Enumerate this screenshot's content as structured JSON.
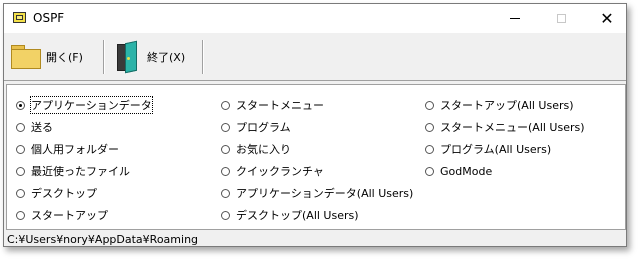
{
  "window": {
    "title": "OSPF"
  },
  "toolbar": {
    "open_label": "開く(F)",
    "exit_label": "終了(X)"
  },
  "options": {
    "col1": [
      {
        "label": "アプリケーションデータ",
        "selected": true
      },
      {
        "label": "送る",
        "selected": false
      },
      {
        "label": "個人用フォルダー",
        "selected": false
      },
      {
        "label": "最近使ったファイル",
        "selected": false
      },
      {
        "label": "デスクトップ",
        "selected": false
      },
      {
        "label": "スタートアップ",
        "selected": false
      }
    ],
    "col2": [
      {
        "label": "スタートメニュー",
        "selected": false
      },
      {
        "label": "プログラム",
        "selected": false
      },
      {
        "label": "お気に入り",
        "selected": false
      },
      {
        "label": "クイックランチャ",
        "selected": false
      },
      {
        "label": "アプリケーションデータ(All Users)",
        "selected": false
      },
      {
        "label": "デスクトップ(All Users)",
        "selected": false
      }
    ],
    "col3": [
      {
        "label": "スタートアップ(All Users)",
        "selected": false
      },
      {
        "label": "スタートメニュー(All Users)",
        "selected": false
      },
      {
        "label": "プログラム(All Users)",
        "selected": false
      },
      {
        "label": "GodMode",
        "selected": false
      }
    ]
  },
  "status": {
    "path": "C:¥Users¥nory¥AppData¥Roaming"
  }
}
